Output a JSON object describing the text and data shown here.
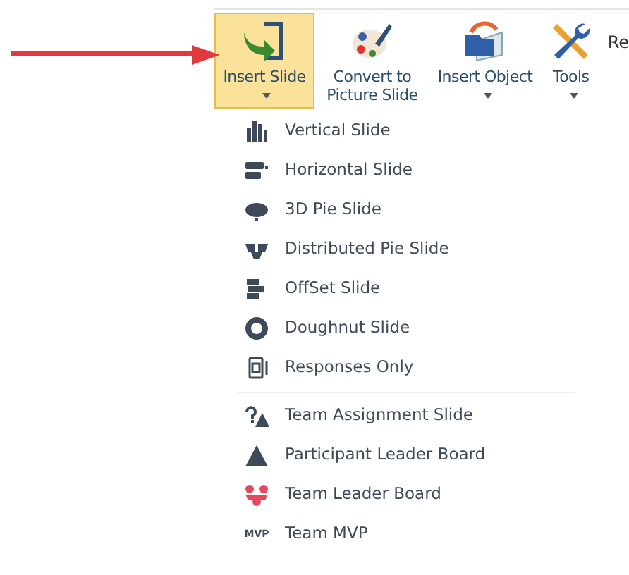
{
  "ribbon": {
    "buttons": [
      {
        "kind": "insert-slide",
        "label": "Insert Slide",
        "selected": true,
        "has_dropdown": true
      },
      {
        "kind": "convert",
        "label": "Convert to Picture Slide",
        "selected": false,
        "has_dropdown": false
      },
      {
        "kind": "insert-object",
        "label": "Insert Object",
        "selected": false,
        "has_dropdown": true
      },
      {
        "kind": "tools",
        "label": "Tools",
        "selected": false,
        "has_dropdown": true
      }
    ],
    "cut_label": "Re"
  },
  "menu": {
    "groups": [
      {
        "items": [
          {
            "kind": "vertical",
            "label": "Vertical Slide",
            "color": "#3d4a59"
          },
          {
            "kind": "horizontal",
            "label": "Horizontal Slide",
            "color": "#3d4a59"
          },
          {
            "kind": "pie3d",
            "label": "3D Pie Slide",
            "color": "#3d4a59"
          },
          {
            "kind": "distributed",
            "label": "Distributed Pie Slide",
            "color": "#3d4a59"
          },
          {
            "kind": "offset",
            "label": "OffSet Slide",
            "color": "#3d4a59"
          },
          {
            "kind": "doughnut",
            "label": "Doughnut Slide",
            "color": "#3d4a59"
          },
          {
            "kind": "responses",
            "label": "Responses Only",
            "color": "#3d4a59"
          }
        ]
      },
      {
        "items": [
          {
            "kind": "team-assignment",
            "label": "Team Assignment Slide",
            "color": "#3d4a59"
          },
          {
            "kind": "participant-board",
            "label": "Participant Leader Board",
            "color": "#3d4a59"
          },
          {
            "kind": "team-board",
            "label": "Team Leader Board",
            "color": "#e8485d"
          },
          {
            "kind": "mvp",
            "label": "Team MVP",
            "icon_text": "MVP",
            "color": "#3d4a59"
          }
        ]
      }
    ]
  }
}
